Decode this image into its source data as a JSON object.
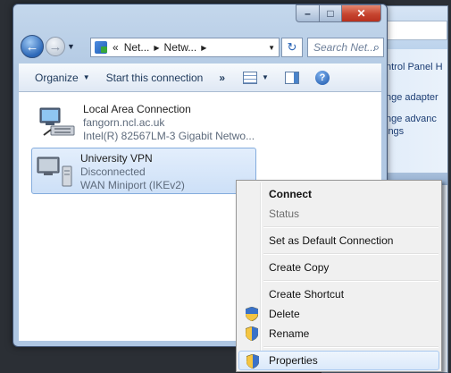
{
  "background_window": {
    "links": [
      "ntrol Panel H",
      "nge adapter",
      "nge advanc",
      "ings"
    ]
  },
  "window": {
    "address": {
      "crumbs": [
        "Net...",
        "Netw..."
      ],
      "prefix": "«"
    },
    "search": {
      "placeholder": "Search Net..."
    },
    "toolbar": {
      "organize": "Organize",
      "start": "Start this connection",
      "more": "»"
    },
    "connections": [
      {
        "name": "Local Area Connection",
        "line2": "fangorn.ncl.ac.uk",
        "line3": "Intel(R) 82567LM-3 Gigabit Netwo..."
      },
      {
        "name": "University VPN",
        "line2": "Disconnected",
        "line3": "WAN Miniport (IKEv2)"
      }
    ]
  },
  "context_menu": {
    "items": {
      "connect": "Connect",
      "status": "Status",
      "set_default": "Set as Default Connection",
      "create_copy": "Create Copy",
      "create_shortcut": "Create Shortcut",
      "delete": "Delete",
      "rename": "Rename",
      "properties": "Properties"
    }
  }
}
